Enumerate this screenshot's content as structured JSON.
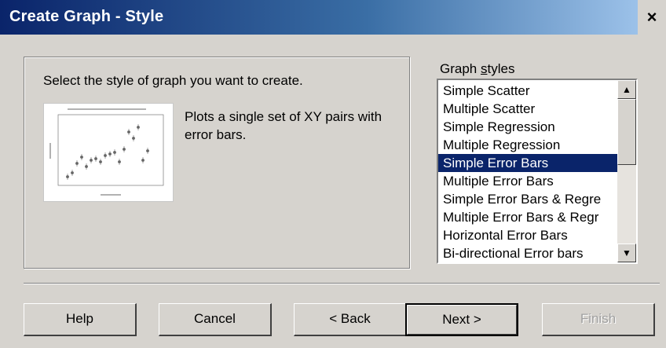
{
  "window": {
    "title": "Create Graph - Style",
    "close_glyph": "×"
  },
  "main": {
    "prompt": "Select the style of graph you want to create.",
    "description": "Plots a single set of XY pairs with error bars."
  },
  "styles": {
    "label_prefix": "Graph ",
    "label_underlined": "s",
    "label_suffix": "tyles",
    "items": [
      "Simple Scatter",
      "Multiple Scatter",
      "Simple Regression",
      "Multiple Regression",
      "Simple Error Bars",
      "Multiple Error Bars",
      "Simple Error Bars & Regre",
      "Multiple Error Bars & Regr",
      "Horizontal Error Bars",
      "Bi-directional Error bars"
    ],
    "selected_index": 4
  },
  "buttons": {
    "help": "Help",
    "cancel": "Cancel",
    "back": "< Back",
    "next": "Next >",
    "finish": "Finish"
  },
  "colors": {
    "selection": "#0a246a",
    "dialog_bg": "#d6d3ce"
  },
  "icons": {
    "scroll_up": "up-arrow-icon",
    "scroll_down": "down-arrow-icon"
  }
}
